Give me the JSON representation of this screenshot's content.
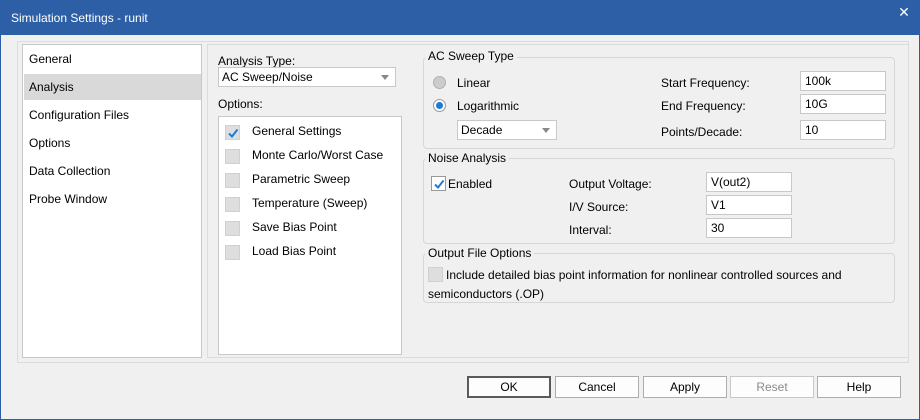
{
  "window": {
    "title": "Simulation Settings - runit",
    "close_glyph": "✕"
  },
  "nav": {
    "items": [
      {
        "label": "General"
      },
      {
        "label": "Analysis",
        "selected": true
      },
      {
        "label": "Configuration Files"
      },
      {
        "label": "Options"
      },
      {
        "label": "Data Collection"
      },
      {
        "label": "Probe Window"
      }
    ]
  },
  "analysis": {
    "type_label": "Analysis Type:",
    "type_value": "AC Sweep/Noise",
    "options_label": "Options:",
    "options": [
      {
        "label": "General Settings",
        "checked": true
      },
      {
        "label": "Monte Carlo/Worst Case",
        "checked": false
      },
      {
        "label": "Parametric Sweep",
        "checked": false
      },
      {
        "label": "Temperature (Sweep)",
        "checked": false
      },
      {
        "label": "Save Bias Point",
        "checked": false
      },
      {
        "label": "Load Bias Point",
        "checked": false
      }
    ]
  },
  "ac_sweep": {
    "group_title": "AC Sweep Type",
    "linear_label": "Linear",
    "log_label": "Logarithmic",
    "selected": "Logarithmic",
    "log_type": "Decade",
    "start_label": "Start Frequency:",
    "start_value": "100k",
    "end_label": "End Frequency:",
    "end_value": "10G",
    "points_label": "Points/Decade:",
    "points_value": "10"
  },
  "noise": {
    "group_title": "Noise Analysis",
    "enabled_label": "Enabled",
    "enabled": true,
    "output_voltage_label": "Output Voltage:",
    "output_voltage_value": "V(out2)",
    "iv_source_label": "I/V Source:",
    "iv_source_value": "V1",
    "interval_label": "Interval:",
    "interval_value": "30"
  },
  "output_file": {
    "group_title": "Output File Options",
    "checkbox_label_line1": "Include detailed bias point information for nonlinear controlled sources and",
    "checkbox_label_line2": "semiconductors (.OP)",
    "checked": false
  },
  "buttons": {
    "ok": "OK",
    "cancel": "Cancel",
    "apply": "Apply",
    "reset": "Reset",
    "help": "Help"
  },
  "colors": {
    "title_bar": "#2d5fa6",
    "accent_check": "#1d7bd8",
    "selected_nav": "#d9d9d9",
    "dialog_bg": "#f0f0f0"
  }
}
